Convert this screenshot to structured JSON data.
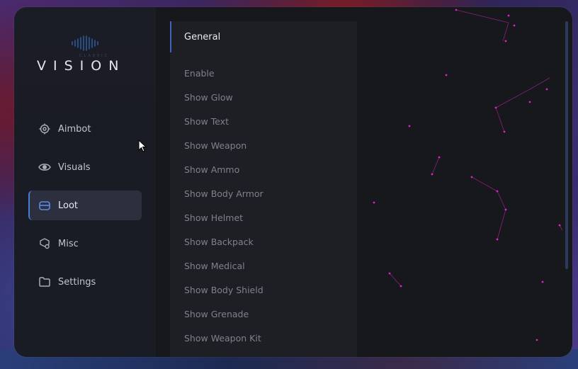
{
  "brand": {
    "subtitle": "CLASSIC",
    "title": "VISION"
  },
  "sidebar": {
    "items": [
      {
        "label": "Aimbot",
        "icon": "crosshair-icon",
        "active": false
      },
      {
        "label": "Visuals",
        "icon": "eye-icon",
        "active": false
      },
      {
        "label": "Loot",
        "icon": "chest-icon",
        "active": true
      },
      {
        "label": "Misc",
        "icon": "misc-icon",
        "active": false
      },
      {
        "label": "Settings",
        "icon": "folder-icon",
        "active": false
      }
    ]
  },
  "panel": {
    "header": "General",
    "options": [
      "Enable",
      "Show Glow",
      "Show Text",
      "Show Weapon",
      "Show Ammo",
      "Show Body Armor",
      "Show Helmet",
      "Show Backpack",
      "Show Medical",
      "Show Body Shield",
      "Show Grenade",
      "Show Weapon Kit"
    ]
  },
  "colors": {
    "accent": "#3f63b8",
    "particle": "#e020c8",
    "window_bg": "#17181c",
    "panel_bg": "#1e1f24"
  }
}
